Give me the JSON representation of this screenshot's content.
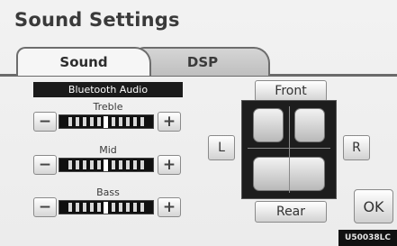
{
  "title": "Sound Settings",
  "tabs": [
    {
      "label": "Sound",
      "active": true
    },
    {
      "label": "DSP",
      "active": false
    }
  ],
  "source_label": "Bluetooth Audio",
  "controls": [
    {
      "label": "Treble",
      "minus": "−",
      "plus": "+",
      "level": 0.5
    },
    {
      "label": "Mid",
      "minus": "−",
      "plus": "+",
      "level": 0.5
    },
    {
      "label": "Bass",
      "minus": "−",
      "plus": "+",
      "level": 0.5
    }
  ],
  "balance": {
    "front_label": "Front",
    "rear_label": "Rear",
    "left_label": "L",
    "right_label": "R"
  },
  "ok_label": "OK",
  "image_code": "U50038LC",
  "colors": {
    "background": "#efefef",
    "panel_dark": "#1d1d1d",
    "tab_border": "#6d6d6d"
  }
}
